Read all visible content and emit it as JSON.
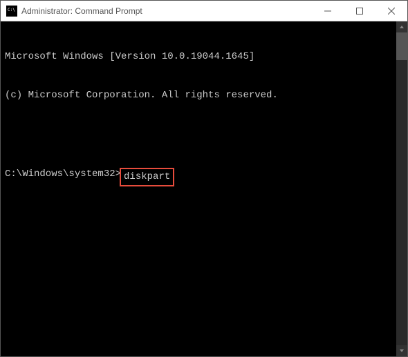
{
  "window": {
    "title": "Administrator: Command Prompt"
  },
  "terminal": {
    "line1": "Microsoft Windows [Version 10.0.19044.1645]",
    "line2": "(c) Microsoft Corporation. All rights reserved.",
    "prompt": "C:\\Windows\\system32>",
    "command": "diskpart"
  }
}
